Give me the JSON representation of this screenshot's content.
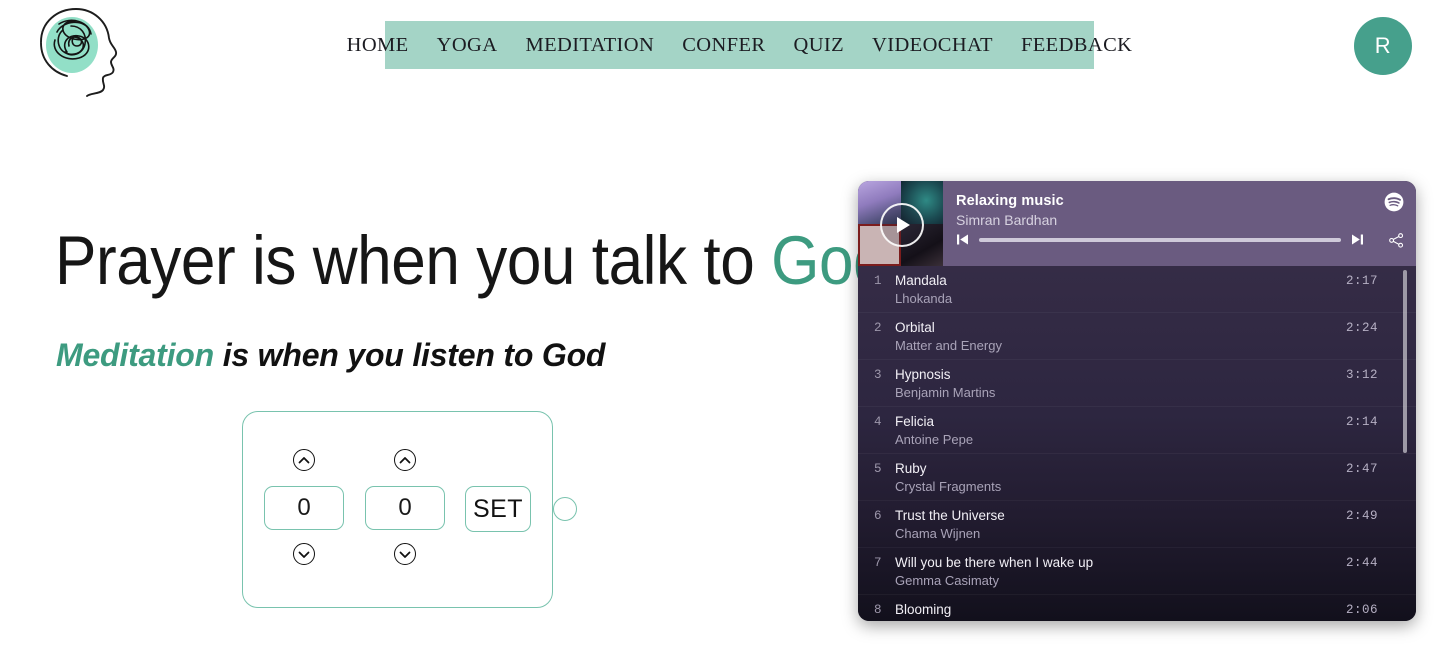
{
  "header": {
    "logo_alt": "head with tangled thoughts logo",
    "nav": [
      {
        "label": "HOME"
      },
      {
        "label": "YOGA"
      },
      {
        "label": "MEDITATION"
      },
      {
        "label": "CONFER"
      },
      {
        "label": "QUIZ"
      },
      {
        "label": "VIDEOCHAT"
      },
      {
        "label": "FEEDBACK"
      }
    ],
    "avatar_initial": "R",
    "nav_bg": "#a4d4c6",
    "avatar_bg": "#46a08c"
  },
  "hero": {
    "headline_part1": "Prayer is when you talk to ",
    "headline_accent": "God",
    "subhead_accent": "Meditation",
    "subhead_rest": " is when you listen to God",
    "accent_color": "#3d9b80"
  },
  "timer": {
    "hours_value": "0",
    "minutes_value": "0",
    "set_label": "SET",
    "border_color": "#79c3ae"
  },
  "player": {
    "title": "Relaxing music",
    "artist": "Simran Bardhan",
    "header_bg": "#6a5b80",
    "tracks": [
      {
        "num": "1",
        "name": "Mandala",
        "artist": "Lhokanda",
        "duration": "2:17"
      },
      {
        "num": "2",
        "name": "Orbital",
        "artist": "Matter and Energy",
        "duration": "2:24"
      },
      {
        "num": "3",
        "name": "Hypnosis",
        "artist": "Benjamin Martins",
        "duration": "3:12"
      },
      {
        "num": "4",
        "name": "Felicia",
        "artist": "Antoine Pepe",
        "duration": "2:14"
      },
      {
        "num": "5",
        "name": "Ruby",
        "artist": "Crystal Fragments",
        "duration": "2:47"
      },
      {
        "num": "6",
        "name": "Trust the Universe",
        "artist": "Chama Wijnen",
        "duration": "2:49"
      },
      {
        "num": "7",
        "name": "Will you be there when I wake up",
        "artist": "Gemma Casimaty",
        "duration": "2:44"
      },
      {
        "num": "8",
        "name": "Blooming",
        "artist": "",
        "duration": "2:06"
      }
    ]
  }
}
